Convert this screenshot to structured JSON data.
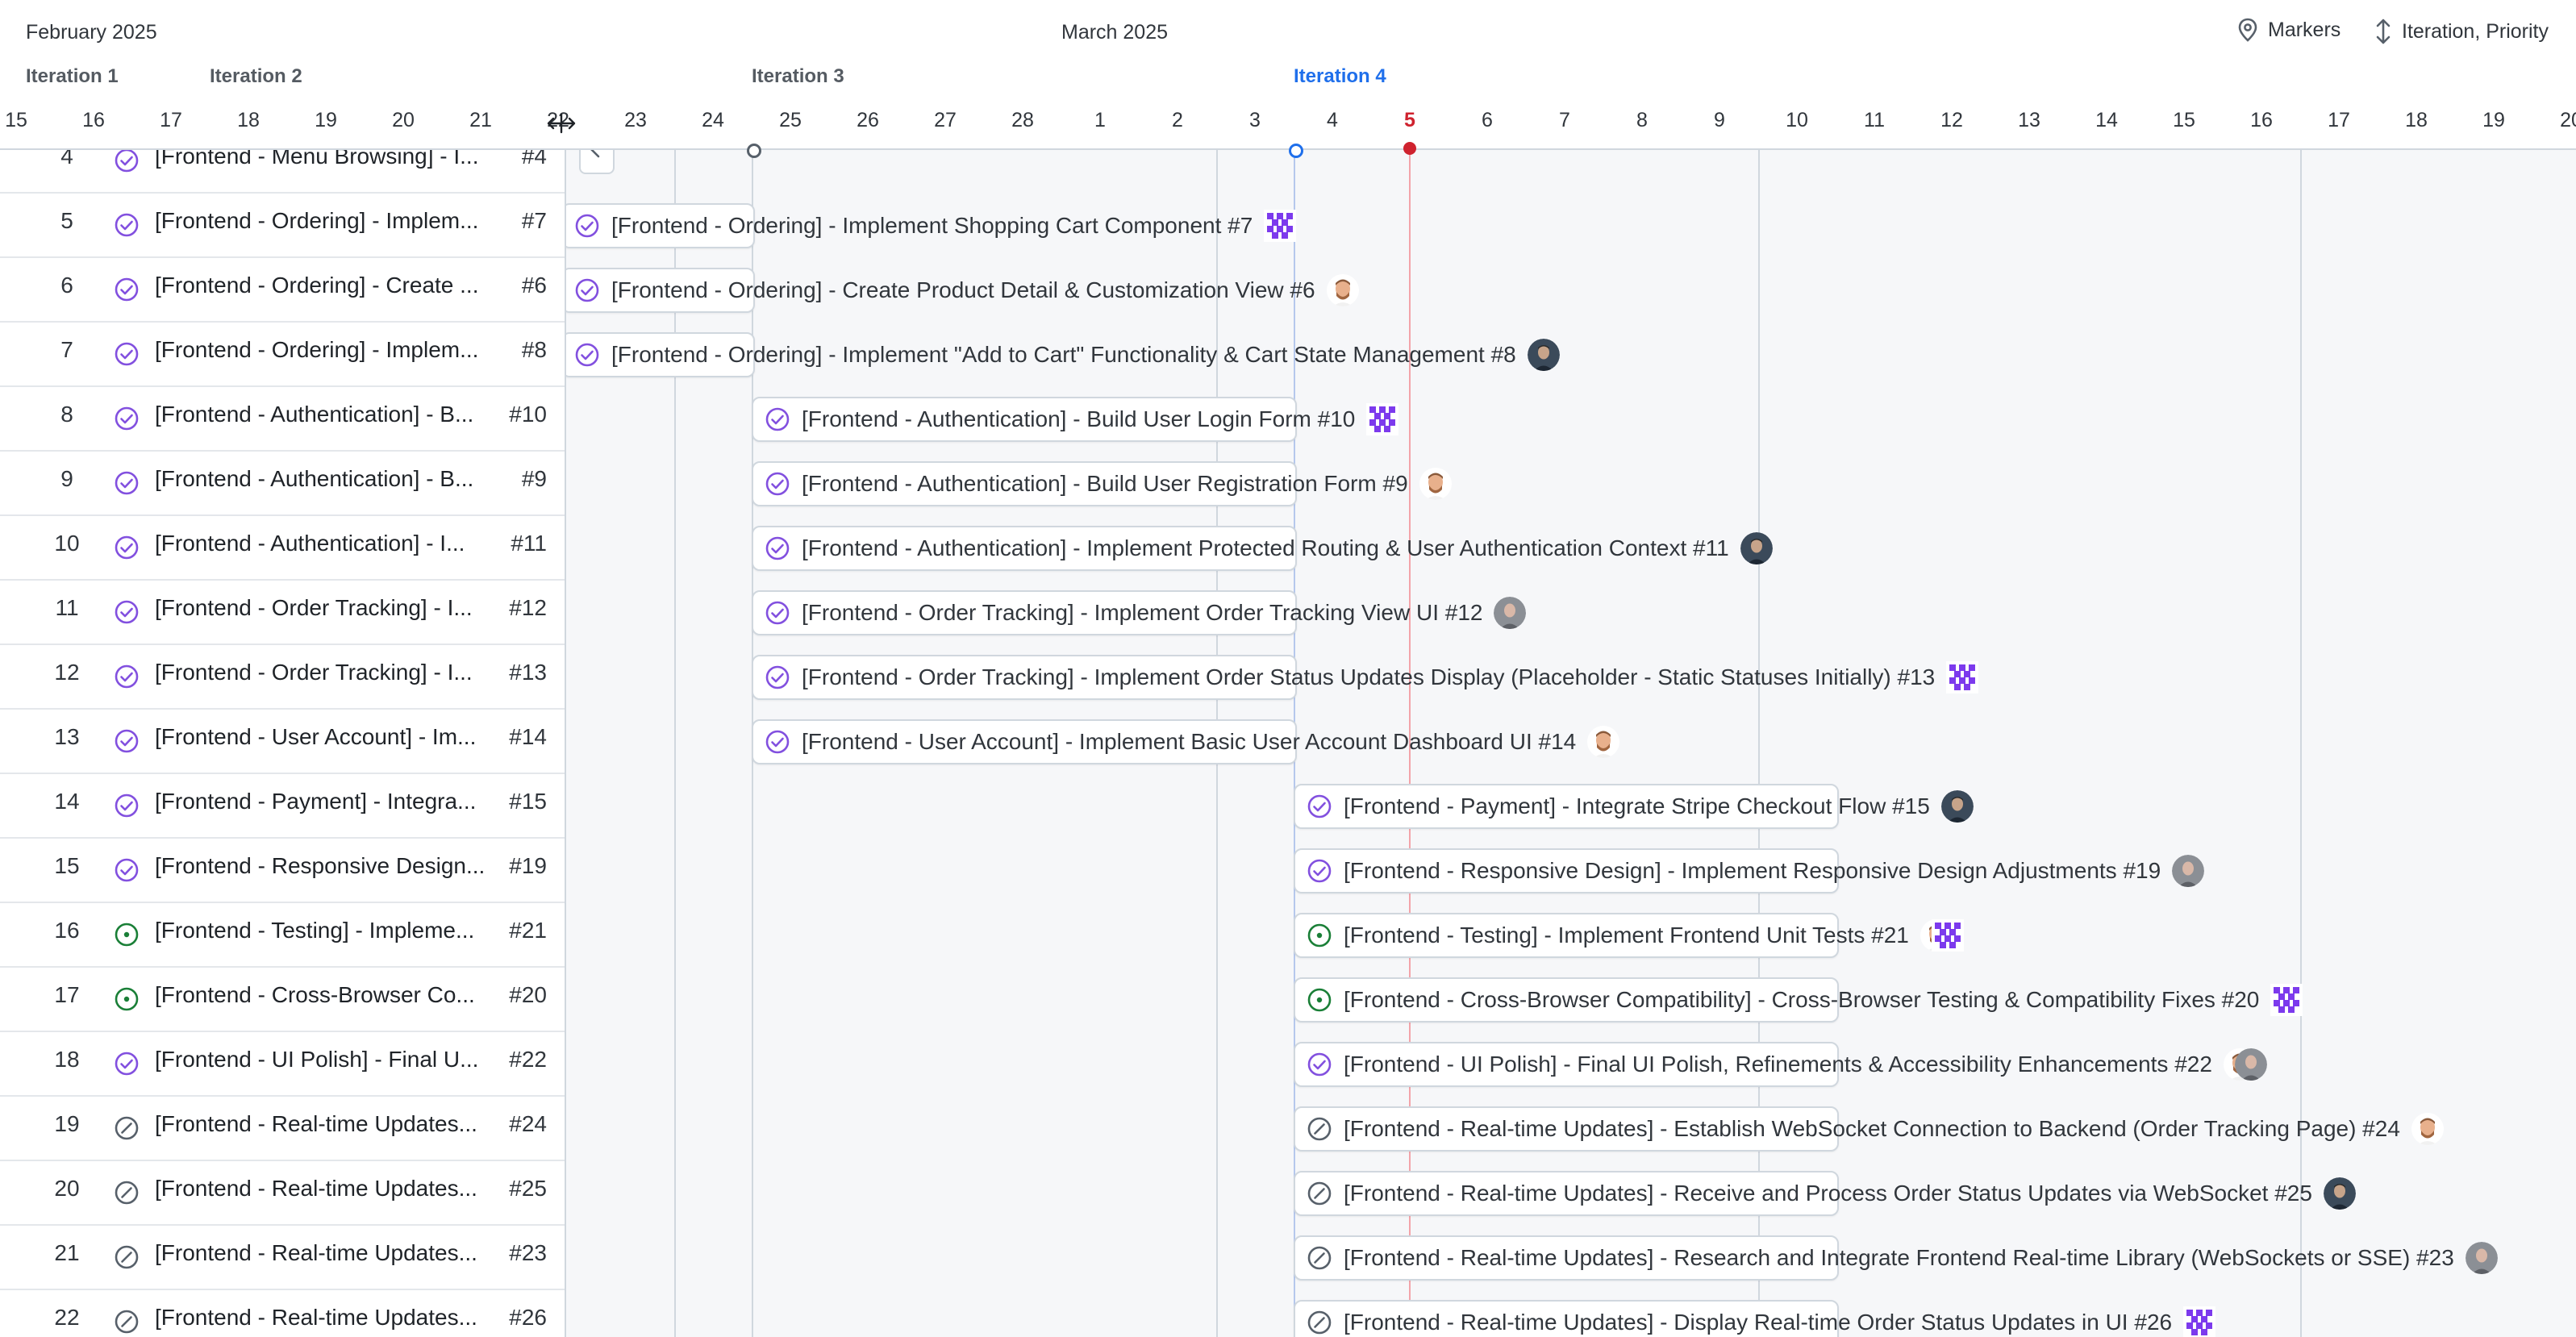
{
  "header": {
    "months": [
      "February 2025",
      "March 2025"
    ],
    "iterations": [
      {
        "label": "Iteration 1",
        "current": false
      },
      {
        "label": "Iteration 2",
        "current": false
      },
      {
        "label": "Iteration 3",
        "current": false
      },
      {
        "label": "Iteration 4",
        "current": true
      }
    ],
    "days": [
      "15",
      "16",
      "17",
      "18",
      "19",
      "20",
      "21",
      "22",
      "23",
      "24",
      "25",
      "26",
      "27",
      "28",
      "1",
      "2",
      "3",
      "4",
      "5",
      "6",
      "7",
      "8",
      "9",
      "10",
      "11",
      "12",
      "13",
      "14",
      "15",
      "16",
      "17",
      "18",
      "19",
      "20"
    ],
    "today_label": "5",
    "markers_label": "Markers",
    "sort_label": "Iteration, Priority"
  },
  "colors": {
    "done": "#8250df",
    "open": "#1a7f37",
    "closed": "#57606a",
    "today": "#cf222e",
    "current_iteration": "#1f6feb"
  },
  "rows": [
    {
      "num": "4",
      "status": "done",
      "short": "[Frontend - Menu Browsing] - I...",
      "id": "#4",
      "full": "",
      "avatar": ""
    },
    {
      "num": "5",
      "status": "done",
      "short": "[Frontend - Ordering] - Implem...",
      "id": "#7",
      "full": "[Frontend - Ordering] - Implement Shopping Cart Component #7",
      "avatar": "pixel"
    },
    {
      "num": "6",
      "status": "done",
      "short": "[Frontend - Ordering] - Create ...",
      "id": "#6",
      "full": "[Frontend - Ordering] - Create Product Detail & Customization View #6",
      "avatar": "beard"
    },
    {
      "num": "7",
      "status": "done",
      "short": "[Frontend - Ordering] - Implem...",
      "id": "#8",
      "full": "[Frontend - Ordering] - Implement \"Add to Cart\" Functionality & Cart State Management #8",
      "avatar": "photo"
    },
    {
      "num": "8",
      "status": "done",
      "short": "[Frontend - Authentication] - B...",
      "id": "#10",
      "full": "[Frontend - Authentication] - Build User Login Form #10",
      "avatar": "pixel"
    },
    {
      "num": "9",
      "status": "done",
      "short": "[Frontend - Authentication] - B...",
      "id": "#9",
      "full": "[Frontend - Authentication] - Build User Registration Form #9",
      "avatar": "beard"
    },
    {
      "num": "10",
      "status": "done",
      "short": "[Frontend - Authentication] - I...",
      "id": "#11",
      "full": "[Frontend - Authentication] - Implement Protected Routing & User Authentication Context #11",
      "avatar": "photo"
    },
    {
      "num": "11",
      "status": "done",
      "short": "[Frontend - Order Tracking] - I...",
      "id": "#12",
      "full": "[Frontend - Order Tracking] - Implement Order Tracking View UI #12",
      "avatar": "grey"
    },
    {
      "num": "12",
      "status": "done",
      "short": "[Frontend - Order Tracking] - I...",
      "id": "#13",
      "full": "[Frontend - Order Tracking] - Implement Order Status Updates Display (Placeholder - Static Statuses Initially) #13",
      "avatar": "pixel"
    },
    {
      "num": "13",
      "status": "done",
      "short": "[Frontend - User Account] - Im...",
      "id": "#14",
      "full": "[Frontend - User Account] - Implement Basic User Account Dashboard UI #14",
      "avatar": "beard"
    },
    {
      "num": "14",
      "status": "done",
      "short": "[Frontend - Payment] - Integra...",
      "id": "#15",
      "full": "[Frontend - Payment] - Integrate Stripe Checkout Flow #15",
      "avatar": "photo"
    },
    {
      "num": "15",
      "status": "done",
      "short": "[Frontend - Responsive Design...",
      "id": "#19",
      "full": "[Frontend - Responsive Design] - Implement Responsive Design Adjustments #19",
      "avatar": "grey"
    },
    {
      "num": "16",
      "status": "open",
      "short": "[Frontend - Testing] - Impleme...",
      "id": "#21",
      "full": "[Frontend - Testing] - Implement Frontend Unit Tests #21",
      "avatar": "beard+pixel"
    },
    {
      "num": "17",
      "status": "open",
      "short": "[Frontend - Cross-Browser Co...",
      "id": "#20",
      "full": "[Frontend - Cross-Browser Compatibility] - Cross-Browser Testing & Compatibility Fixes #20",
      "avatar": "pixel"
    },
    {
      "num": "18",
      "status": "done",
      "short": "[Frontend - UI Polish] - Final U...",
      "id": "#22",
      "full": "[Frontend - UI Polish] - Final UI Polish, Refinements & Accessibility Enhancements #22",
      "avatar": "beard+grey"
    },
    {
      "num": "19",
      "status": "closed",
      "short": "[Frontend - Real-time Updates...",
      "id": "#24",
      "full": "[Frontend - Real-time Updates] - Establish WebSocket Connection to Backend (Order Tracking Page) #24",
      "avatar": "beard"
    },
    {
      "num": "20",
      "status": "closed",
      "short": "[Frontend - Real-time Updates...",
      "id": "#25",
      "full": "[Frontend - Real-time Updates] - Receive and Process Order Status Updates via WebSocket #25",
      "avatar": "photo"
    },
    {
      "num": "21",
      "status": "closed",
      "short": "[Frontend - Real-time Updates...",
      "id": "#23",
      "full": "[Frontend - Real-time Updates] - Research and Integrate Frontend Real-time Library (WebSockets or SSE) #23",
      "avatar": "grey"
    },
    {
      "num": "22",
      "status": "closed",
      "short": "[Frontend - Real-time Updates...",
      "id": "#26",
      "full": "[Frontend - Real-time Updates] - Display Real-time Order Status Updates in UI #26",
      "avatar": "pixel"
    }
  ]
}
